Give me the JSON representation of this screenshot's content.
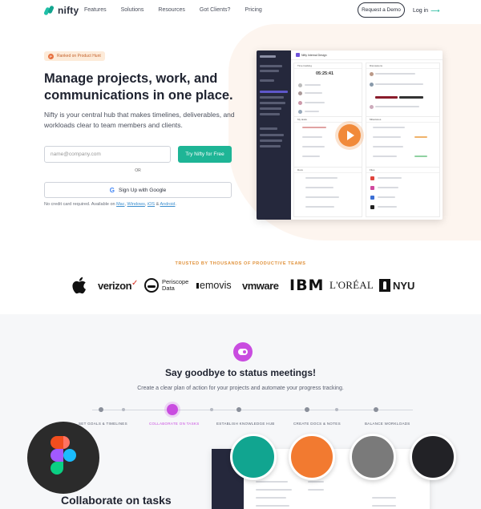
{
  "nav": {
    "logo_text": "nifty",
    "links": [
      "Features",
      "Solutions",
      "Resources",
      "Got Clients?",
      "Pricing"
    ],
    "demo_button": "Request a Demo",
    "login": "Log in",
    "login_arrow": "⟶"
  },
  "hero": {
    "badge": "Ranked on Product Hunt",
    "badge_icon": "P",
    "headline": "Manage projects, work, and communications in one place.",
    "subtext": "Nifty is your central hub that makes timelines, deliverables, and workloads clear to team members and clients.",
    "email_placeholder": "name@company.com",
    "cta": "Try Nifty for Free",
    "or": "OR",
    "google_g": "G",
    "google_button": "Sign Up with Google",
    "nocard_prefix": "No credit card required. Available on ",
    "platform_mac": "Mac",
    "platform_windows": "Windows",
    "platform_ios": "iOS",
    "platform_and": " & ",
    "platform_android": "Android",
    "sep1": ", ",
    "sep2": ", ",
    "period": "."
  },
  "mockup": {
    "project_title": "Nifty Internal Design",
    "timer": "05:25:41",
    "panel_tracking": "Time tracking",
    "panel_discussions": "Discussions",
    "panel_mytasks": "My tasks",
    "panel_milestones": "Milestones",
    "panel_docs": "Docs",
    "panel_files": "Files"
  },
  "trusted": {
    "heading": "TRUSTED BY THOUSANDS OF PRODUCTIVE TEAMS",
    "brands": {
      "verizon": "verizon",
      "periscope1": "Periscope",
      "periscope2": "Data",
      "emovis": "emovis",
      "vmware": "vmware",
      "ibm": "IBM",
      "loreal": "L'ORÉAL",
      "nyu": "NYU"
    }
  },
  "section": {
    "title": "Say goodbye to status meetings!",
    "subtitle": "Create a clear plan of action for your projects and automate your progress tracking.",
    "steps": [
      "SET GOALS & TIMELINES",
      "COLLABORATE ON TASKS",
      "ESTABLISH KNOWLEDGE HUB",
      "CREATE DOCS & NOTES",
      "BALANCE WORKLOADS"
    ],
    "active_step": 1,
    "feature_title": "Collaborate on tasks"
  },
  "colors": {
    "accent": "#1eb596",
    "purple": "#c94ce0",
    "orange": "#f18a3a",
    "trusted": "#e0923c",
    "theme_teal": "#11a590",
    "theme_orange": "#f27a30",
    "theme_gray": "#7a7a7a",
    "theme_black": "#222226"
  }
}
